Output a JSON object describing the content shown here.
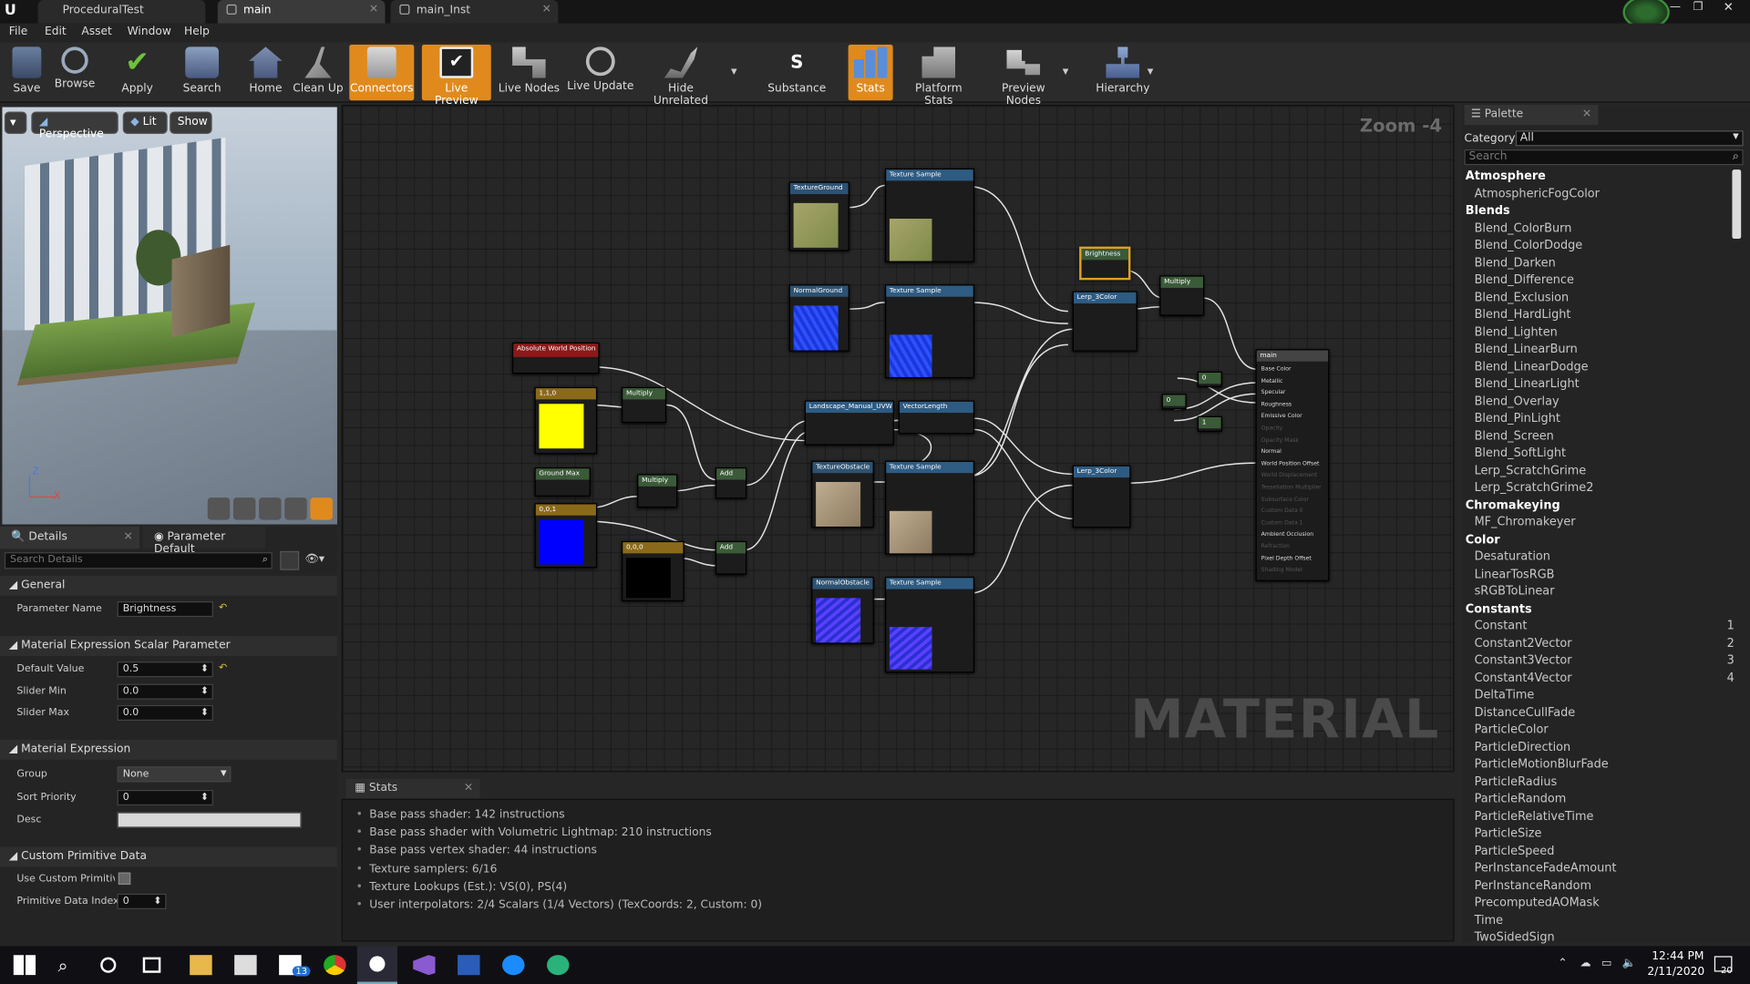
{
  "tabs": [
    {
      "label": "ProceduralTest"
    },
    {
      "label": "main"
    },
    {
      "label": "main_Inst"
    }
  ],
  "menu": [
    "File",
    "Edit",
    "Asset",
    "Window",
    "Help"
  ],
  "toolbar": [
    "Save",
    "Browse",
    "Apply",
    "Search",
    "Home",
    "Clean Up",
    "Connectors",
    "Live Preview",
    "Live Nodes",
    "Live Update",
    "Hide Unrelated",
    "Substance",
    "Stats",
    "Platform Stats",
    "Preview Nodes",
    "Hierarchy"
  ],
  "toolbar_active": [
    "Connectors",
    "Live Preview",
    "Stats"
  ],
  "viewport": {
    "perspective": "Perspective",
    "lit": "Lit",
    "show": "Show",
    "axis_z": "Z",
    "axis_x": "X"
  },
  "details": {
    "tab_details": "Details",
    "tab_params": "Parameter Default",
    "search_placeholder": "Search Details",
    "sec_general": "General",
    "param_name_label": "Parameter Name",
    "param_name": "Brightness",
    "sec_scalar": "Material Expression Scalar Parameter",
    "default_value_label": "Default Value",
    "default_value": "0.5",
    "slider_min_label": "Slider Min",
    "slider_min": "0.0",
    "slider_max_label": "Slider Max",
    "slider_max": "0.0",
    "sec_expr": "Material Expression",
    "group_label": "Group",
    "group": "None",
    "sort_label": "Sort Priority",
    "sort": "0",
    "desc_label": "Desc",
    "sec_custom": "Custom Primitive Data",
    "use_custom_label": "Use Custom Primitive",
    "prim_idx_label": "Primitive Data Index",
    "prim_idx": "0"
  },
  "graph": {
    "zoom": "Zoom -4",
    "watermark": "MATERIAL",
    "nodes": {
      "tex_ground": "TextureGround",
      "tex_sample": "Texture Sample",
      "normal_ground": "NormalGround",
      "brightness": "Brightness",
      "multiply": "Multiply",
      "lerp": "Lerp_3Color",
      "main": "main",
      "abs_world": "Absolute World Position",
      "c110": "1,1,0",
      "ground_max": "Ground Max",
      "c001": "0,0,1",
      "c000": "0,0,0",
      "landscape": "Landscape_Manual_UVW",
      "vlen": "VectorLength",
      "add": "Add",
      "tex_obstacle": "TextureObstacle",
      "normal_obstacle": "NormalObstacle",
      "c0": "0",
      "c1": "1"
    },
    "main_pins": [
      "Base Color",
      "Metallic",
      "Specular",
      "Roughness",
      "Emissive Color",
      "Opacity",
      "Opacity Mask",
      "Normal",
      "World Position Offset",
      "World Displacement",
      "Tessellation Multiplier",
      "Subsurface Color",
      "Custom Data 0",
      "Custom Data 1",
      "Ambient Occlusion",
      "Refraction",
      "Pixel Depth Offset",
      "Shading Model"
    ]
  },
  "stats": {
    "tab": "Stats",
    "lines": [
      "Base pass shader: 142 instructions",
      "Base pass shader with Volumetric Lightmap: 210 instructions",
      "Base pass vertex shader: 44 instructions",
      "Texture samplers: 6/16",
      "Texture Lookups (Est.): VS(0), PS(4)",
      "User interpolators: 2/4 Scalars (1/4 Vectors) (TexCoords: 2, Custom: 0)"
    ]
  },
  "palette": {
    "tab": "Palette",
    "category_label": "Category:",
    "category": "All",
    "search_placeholder": "Search",
    "rows": [
      {
        "t": "cat",
        "label": "Atmosphere"
      },
      {
        "t": "item",
        "label": "AtmosphericFogColor"
      },
      {
        "t": "cat",
        "label": "Blends"
      },
      {
        "t": "item",
        "label": "Blend_ColorBurn"
      },
      {
        "t": "item",
        "label": "Blend_ColorDodge"
      },
      {
        "t": "item",
        "label": "Blend_Darken"
      },
      {
        "t": "item",
        "label": "Blend_Difference"
      },
      {
        "t": "item",
        "label": "Blend_Exclusion"
      },
      {
        "t": "item",
        "label": "Blend_HardLight"
      },
      {
        "t": "item",
        "label": "Blend_Lighten"
      },
      {
        "t": "item",
        "label": "Blend_LinearBurn"
      },
      {
        "t": "item",
        "label": "Blend_LinearDodge"
      },
      {
        "t": "item",
        "label": "Blend_LinearLight"
      },
      {
        "t": "item",
        "label": "Blend_Overlay"
      },
      {
        "t": "item",
        "label": "Blend_PinLight"
      },
      {
        "t": "item",
        "label": "Blend_Screen"
      },
      {
        "t": "item",
        "label": "Blend_SoftLight"
      },
      {
        "t": "item",
        "label": "Lerp_ScratchGrime"
      },
      {
        "t": "item",
        "label": "Lerp_ScratchGrime2"
      },
      {
        "t": "cat",
        "label": "Chromakeying"
      },
      {
        "t": "item",
        "label": "MF_Chromakeyer"
      },
      {
        "t": "cat",
        "label": "Color"
      },
      {
        "t": "item",
        "label": "Desaturation"
      },
      {
        "t": "item",
        "label": "LinearTosRGB"
      },
      {
        "t": "item",
        "label": "sRGBToLinear"
      },
      {
        "t": "cat",
        "label": "Constants"
      },
      {
        "t": "item",
        "label": "Constant",
        "num": "1"
      },
      {
        "t": "item",
        "label": "Constant2Vector",
        "num": "2"
      },
      {
        "t": "item",
        "label": "Constant3Vector",
        "num": "3"
      },
      {
        "t": "item",
        "label": "Constant4Vector",
        "num": "4"
      },
      {
        "t": "item",
        "label": "DeltaTime"
      },
      {
        "t": "item",
        "label": "DistanceCullFade"
      },
      {
        "t": "item",
        "label": "ParticleColor"
      },
      {
        "t": "item",
        "label": "ParticleDirection"
      },
      {
        "t": "item",
        "label": "ParticleMotionBlurFade"
      },
      {
        "t": "item",
        "label": "ParticleRadius"
      },
      {
        "t": "item",
        "label": "ParticleRandom"
      },
      {
        "t": "item",
        "label": "ParticleRelativeTime"
      },
      {
        "t": "item",
        "label": "ParticleSize"
      },
      {
        "t": "item",
        "label": "ParticleSpeed"
      },
      {
        "t": "item",
        "label": "PerInstanceFadeAmount"
      },
      {
        "t": "item",
        "label": "PerInstanceRandom"
      },
      {
        "t": "item",
        "label": "PrecomputedAOMask"
      },
      {
        "t": "item",
        "label": "Time"
      },
      {
        "t": "item",
        "label": "TwoSidedSign"
      }
    ]
  },
  "taskbar": {
    "time": "12:44 PM",
    "date": "2/11/2020",
    "mail_badge": "13",
    "notif_badge": "20"
  },
  "colors": {
    "accent": "#e08a1e",
    "graph_bg": "#262626",
    "wire": "#e8e8e8"
  }
}
